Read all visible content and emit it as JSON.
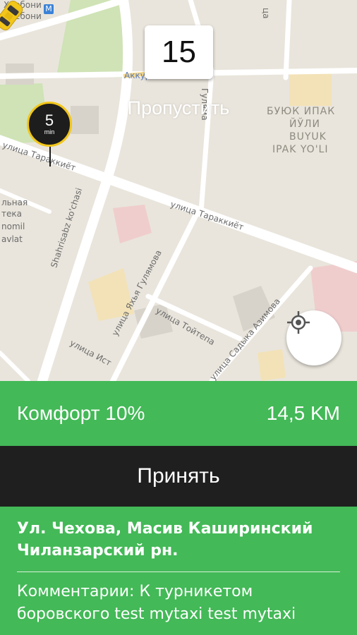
{
  "map": {
    "labels": {
      "hiyoboni_top": "Хиебони",
      "hiyoboni_bottom": "Хиебони",
      "metro_badge": "M",
      "akkurgan": "Аккур",
      "gulyamova_top": "Гуляма",
      "street_vertical_top": "ца",
      "buyuk_ipak_cyr_1": "БУЮК ИПАК",
      "buyuk_ipak_cyr_2": "ЙЎЛИ",
      "buyuk_ipak_lat_1": "BUYUK",
      "buyuk_ipak_lat_2": "IPAK YO'LI",
      "tarakkiet_left": "улица Тараккиёт",
      "tarakkiet_right": "улица Тараккиёт",
      "shahrisabz": "Shahrisabz ko'chasi",
      "hospital_1": "льная",
      "hospital_2": "тека",
      "hospital_3": "nomil",
      "hospital_4": "avlat",
      "yalya_gulyamova": "улица Яхья Гулямова",
      "toitepa": "улица Тойтепа",
      "sadyka_azimova": "улица Садыка Азимова",
      "istiklol": "улица Ист"
    },
    "eta_pin": {
      "value": "5",
      "unit": "min"
    },
    "locate_button": "crosshair-icon"
  },
  "counter": {
    "value": "15"
  },
  "skip_label": "Пропустить",
  "order": {
    "tariff": "Комфорт 10%",
    "distance": "14,5 KM",
    "accept_label": "Принять",
    "address": "Ул. Чехова, Масив Каширинский Чиланзарский рн.",
    "comment": "Комментарии: К турникетом боровского test mytaxi test mytaxi"
  },
  "colors": {
    "accent_green": "#43b957",
    "accept_bg": "#1f1f1f",
    "map_bg": "#e9e5dc",
    "taxi_yellow": "#f2c61a"
  }
}
